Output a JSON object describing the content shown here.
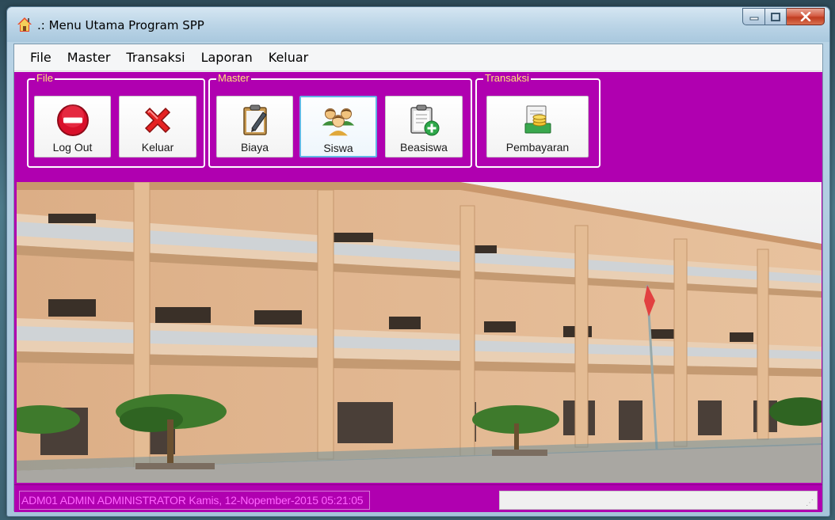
{
  "window": {
    "title": ".: Menu Utama Program SPP"
  },
  "menubar": {
    "items": [
      "File",
      "Master",
      "Transaksi",
      "Laporan",
      "Keluar"
    ]
  },
  "toolbar": {
    "groups": [
      {
        "label": "File",
        "buttons": [
          {
            "label": "Log Out",
            "icon": "logout-icon"
          },
          {
            "label": "Keluar",
            "icon": "close-x-icon"
          }
        ]
      },
      {
        "label": "Master",
        "buttons": [
          {
            "label": "Biaya",
            "icon": "clipboard-pen-icon"
          },
          {
            "label": "Siswa",
            "icon": "users-group-icon"
          },
          {
            "label": "Beasiswa",
            "icon": "clipboard-add-icon"
          }
        ]
      },
      {
        "label": "Transaksi",
        "buttons": [
          {
            "label": "Pembayaran",
            "icon": "payment-icon"
          }
        ]
      }
    ]
  },
  "statusbar": {
    "text": "ADM01  ADMIN  ADMINISTRATOR  Kamis, 12-Nopember-2015  05:21:05"
  },
  "colors": {
    "accent": "#b000b0",
    "status_text": "#ff66ff",
    "group_label": "#ffe27a"
  }
}
